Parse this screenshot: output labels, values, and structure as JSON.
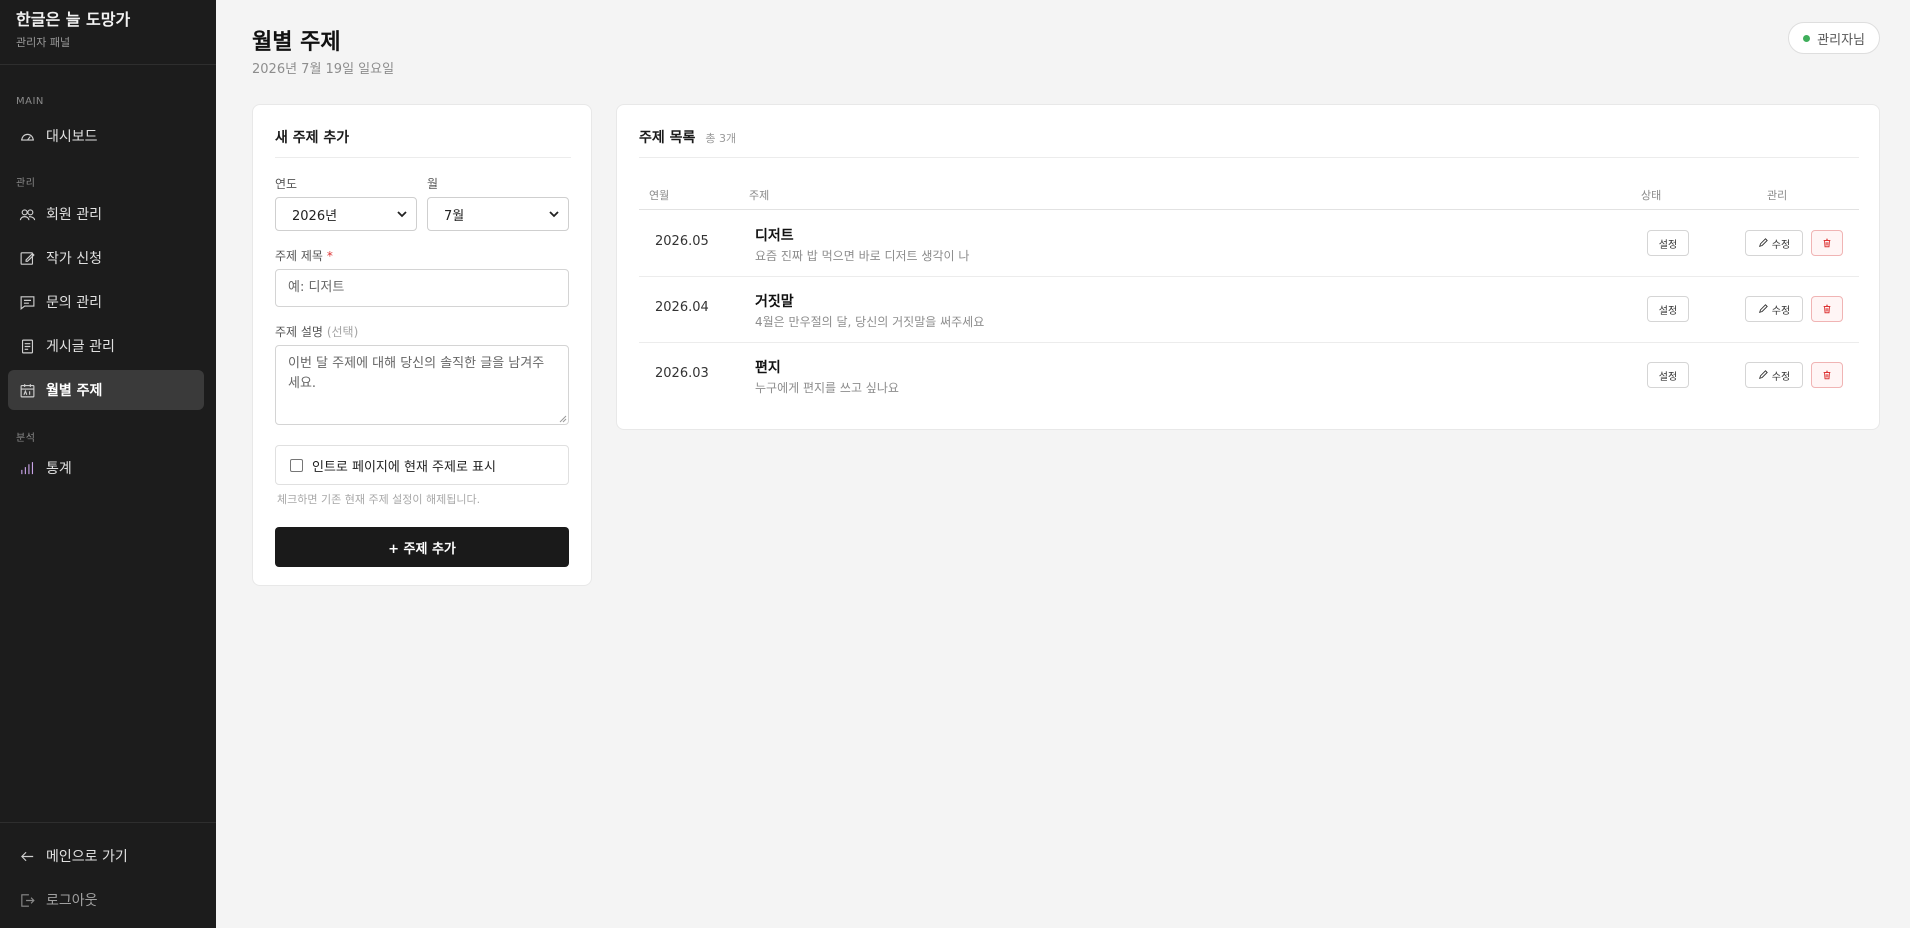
{
  "sidebar": {
    "brand_title": "한글은 늘 도망가",
    "brand_sub": "관리자 패널",
    "sections": {
      "main": "MAIN",
      "manage": "관리",
      "analytics": "분석"
    },
    "items": {
      "dashboard": "대시보드",
      "members": "회원 관리",
      "writer_apply": "작가 신청",
      "inquiries": "문의 관리",
      "posts": "게시글 관리",
      "monthly_topic": "월별 주제",
      "stats": "통계"
    },
    "go_main": "메인으로 가기",
    "logout": "로그아웃"
  },
  "header": {
    "title": "월별 주제",
    "date": "2026년 7월 19일 일요일",
    "admin_label": "관리자님"
  },
  "form": {
    "title": "새 주제 추가",
    "year_label": "연도",
    "year_value": "2026년",
    "month_label": "월",
    "month_value": "7월",
    "topic_label": "주제 제목",
    "required_mark": "*",
    "topic_placeholder": "예: 디저트",
    "desc_label": "주제 설명",
    "desc_optional": "(선택)",
    "desc_placeholder": "이번 달 주제에 대해 당신의 솔직한 글을 남겨주세요.",
    "checkbox_label": "인트로 페이지에 현재 주제로 표시",
    "checkbox_hint": "체크하면 기존 현재 주제 설정이 해제됩니다.",
    "submit_label": "+ 주제 추가"
  },
  "list": {
    "title": "주제 목록",
    "count": "총 3개",
    "columns": {
      "date": "연월",
      "topic": "주제",
      "status": "상태",
      "manage": "관리"
    },
    "set_label": "설정",
    "edit_label": "수정",
    "rows": [
      {
        "date": "2026.05",
        "name": "디저트",
        "desc": "요즘 진짜 밥 먹으면 바로 디저트 생각이 나"
      },
      {
        "date": "2026.04",
        "name": "거짓말",
        "desc": "4월은 만우절의 달, 당신의 거짓말을 써주세요"
      },
      {
        "date": "2026.03",
        "name": "편지",
        "desc": "누구에게 편지를 쓰고 싶나요"
      }
    ]
  },
  "colors": {
    "sidebar_bg": "#1c1c1c",
    "accent_dark": "#1a1a1a",
    "online_dot": "#3fae5b",
    "danger": "#d33"
  }
}
